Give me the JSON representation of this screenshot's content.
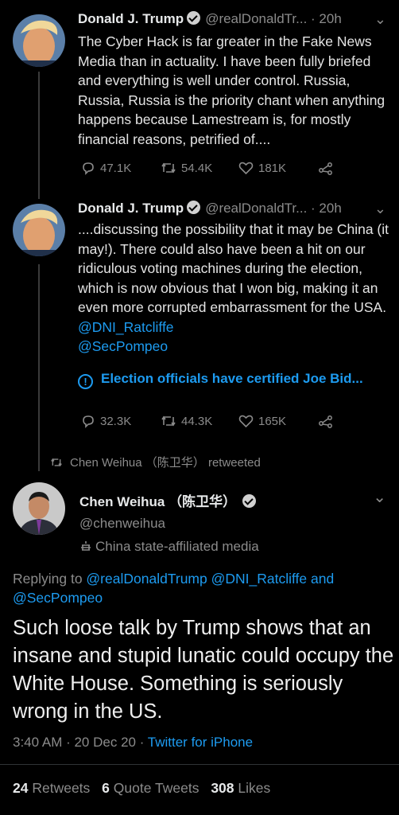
{
  "tweet1": {
    "name": "Donald J. Trump",
    "handle": "@realDonaldTr...",
    "time": "· 20h",
    "text": "The Cyber Hack is far greater in the Fake News Media than in actuality. I have been fully briefed and everything is well under control. Russia, Russia, Russia is the priority chant when anything happens because Lamestream is, for mostly financial reasons, petrified of....",
    "replies": "47.1K",
    "retweets": "54.4K",
    "likes": "181K"
  },
  "tweet2": {
    "name": "Donald J. Trump",
    "handle": "@realDonaldTr...",
    "time": "· 20h",
    "text": "....discussing the possibility that it may be China (it may!). There could also have been a hit on our ridiculous voting machines during the election, which is now obvious that I won big, making it an even more corrupted embarrassment for the USA. ",
    "mention1": "@DNI_Ratcliffe",
    "mention2": "@SecPompeo",
    "notice": "Election officials have certified Joe Bid...",
    "replies": "32.3K",
    "retweets": "44.3K",
    "likes": "165K"
  },
  "retweet_label": "Chen Weihua （陈卫华） retweeted",
  "main": {
    "name": "Chen Weihua （陈卫华）",
    "handle": "@chenweihua",
    "affiliation": "China state-affiliated media",
    "replying_prefix": "Replying to ",
    "replying_to": "@realDonaldTrump @DNI_Ratcliffe and @SecPompeo",
    "text": "Such loose talk by Trump shows that an insane and stupid lunatic could occupy the White House.  Something is seriously wrong in the US.",
    "timestamp": "3:40 AM · 20 Dec 20 · ",
    "source": "Twitter for iPhone",
    "retweets_count": "24",
    "retweets_label": "Retweets",
    "quotes_count": "6",
    "quotes_label": "Quote Tweets",
    "likes_count": "308",
    "likes_label": "Likes"
  }
}
